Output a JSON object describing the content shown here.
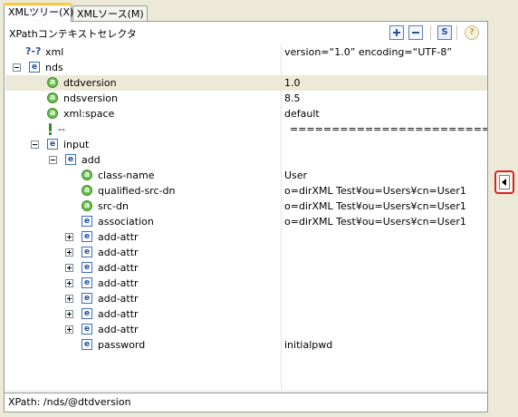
{
  "tabs": [
    {
      "label": "XMLツリー(X)",
      "active": true
    },
    {
      "label": "XMLソース(M)",
      "active": false
    }
  ],
  "panel": {
    "title": "XPathコンテキストセレクタ",
    "toolbar": {
      "expand_icon": "expand-all-icon",
      "collapse_icon": "collapse-all-icon",
      "schema_icon": "schema-icon",
      "schema_glyph": "S",
      "help_icon": "help-icon",
      "help_glyph": "?"
    }
  },
  "tree": {
    "rows": [
      {
        "kind": "pi",
        "icon_text": "?-?",
        "name": "xml",
        "value": "version=“1.0” encoding=“UTF-8”"
      },
      {
        "kind": "element",
        "toggle": "minus",
        "name": "nds",
        "value": ""
      },
      {
        "kind": "attribute",
        "name": "dtdversion",
        "value": "1.0",
        "selected": true
      },
      {
        "kind": "attribute",
        "name": "ndsversion",
        "value": "8.5"
      },
      {
        "kind": "attribute",
        "name": "xml:space",
        "value": "default"
      },
      {
        "kind": "comment",
        "name": "--",
        "value": "================================================"
      },
      {
        "kind": "element",
        "toggle": "minus",
        "name": "input",
        "value": ""
      },
      {
        "kind": "element",
        "toggle": "minus",
        "name": "add",
        "value": ""
      },
      {
        "kind": "attribute",
        "name": "class-name",
        "value": "User"
      },
      {
        "kind": "attribute",
        "name": "qualified-src-dn",
        "value": "o=dirXML Test¥ou=Users¥cn=User1"
      },
      {
        "kind": "attribute",
        "name": "src-dn",
        "value": "o=dirXML Test¥ou=Users¥cn=User1"
      },
      {
        "kind": "element",
        "toggle": "none",
        "name": "association",
        "value": "o=dirXML Test¥ou=Users¥cn=User1"
      },
      {
        "kind": "element",
        "toggle": "plus",
        "name": "add-attr",
        "value": ""
      },
      {
        "kind": "element",
        "toggle": "plus",
        "name": "add-attr",
        "value": ""
      },
      {
        "kind": "element",
        "toggle": "plus",
        "name": "add-attr",
        "value": ""
      },
      {
        "kind": "element",
        "toggle": "plus",
        "name": "add-attr",
        "value": ""
      },
      {
        "kind": "element",
        "toggle": "plus",
        "name": "add-attr",
        "value": ""
      },
      {
        "kind": "element",
        "toggle": "plus",
        "name": "add-attr",
        "value": ""
      },
      {
        "kind": "element",
        "toggle": "plus",
        "name": "add-attr",
        "value": ""
      },
      {
        "kind": "element",
        "toggle": "none",
        "name": "password",
        "value": "initialpwd"
      }
    ]
  },
  "status": {
    "text": "XPath:  /nds/@dtdversion"
  },
  "restore_button": {
    "icon": "restore-view-icon"
  }
}
